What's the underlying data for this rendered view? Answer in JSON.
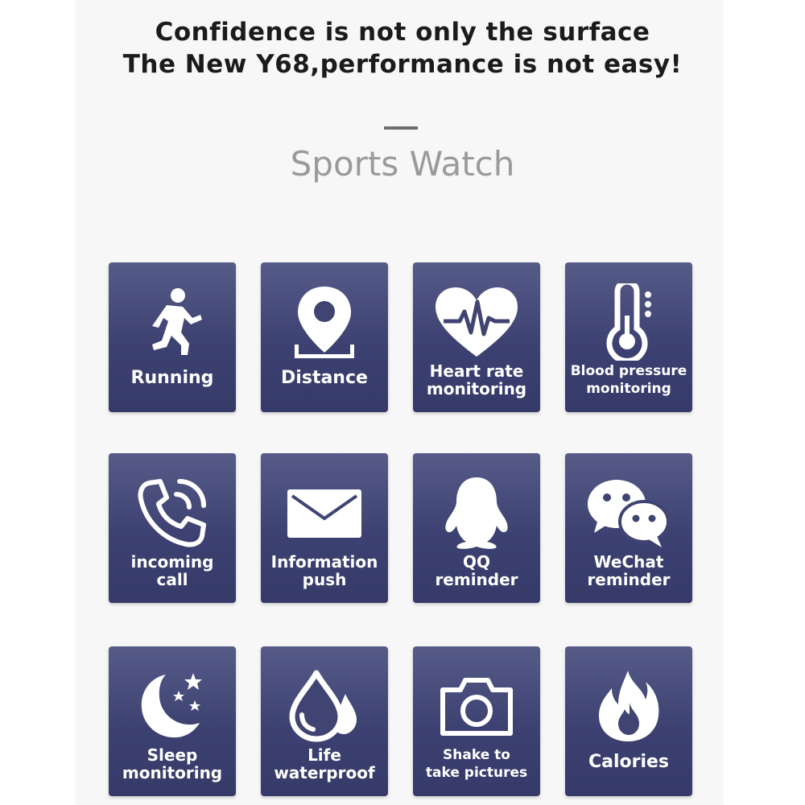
{
  "header": {
    "line1": "Confidence is not only the surface",
    "line2": "The New Y68,performance is not easy!",
    "subtitle": "Sports Watch"
  },
  "colors": {
    "tile": "#3c4171",
    "panel": "#f8f7f7",
    "icon": "#ffffff"
  },
  "features": [
    {
      "icon": "running-icon",
      "label": [
        "Running"
      ]
    },
    {
      "icon": "location-pin-icon",
      "label": [
        "Distance"
      ]
    },
    {
      "icon": "heart-rate-icon",
      "label": [
        "Heart rate",
        "monitoring"
      ]
    },
    {
      "icon": "thermometer-icon",
      "label": [
        "Blood pressure",
        "monitoring"
      ]
    },
    {
      "icon": "phone-call-icon",
      "label": [
        "incoming",
        "call"
      ]
    },
    {
      "icon": "envelope-icon",
      "label": [
        "Information",
        "push"
      ]
    },
    {
      "icon": "qq-penguin-icon",
      "label": [
        "QQ",
        "reminder"
      ]
    },
    {
      "icon": "wechat-icon",
      "label": [
        "WeChat",
        "reminder"
      ]
    },
    {
      "icon": "moon-stars-icon",
      "label": [
        "Sleep",
        "monitoring"
      ]
    },
    {
      "icon": "water-drop-icon",
      "label": [
        "Life",
        "waterproof"
      ]
    },
    {
      "icon": "camera-icon",
      "label": [
        "Shake to",
        "take pictures"
      ]
    },
    {
      "icon": "flame-icon",
      "label": [
        "Calories"
      ]
    }
  ]
}
